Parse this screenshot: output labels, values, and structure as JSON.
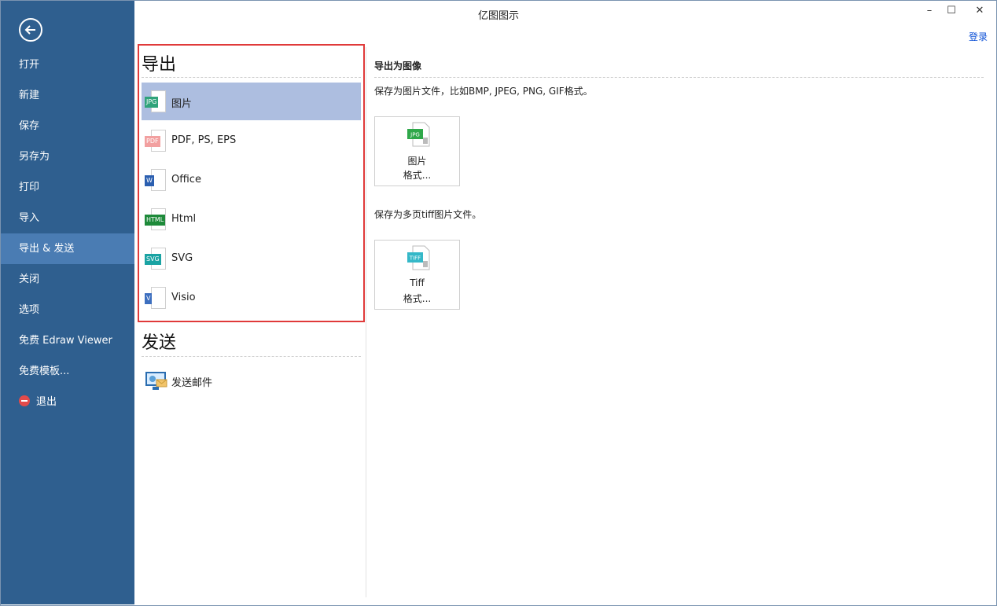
{
  "window": {
    "title": "亿图图示",
    "minimize": "–",
    "maximize": "☐",
    "close": "✕",
    "login": "登录"
  },
  "sidebar": {
    "items": [
      {
        "label": "打开",
        "active": false
      },
      {
        "label": "新建",
        "active": false
      },
      {
        "label": "保存",
        "active": false
      },
      {
        "label": "另存为",
        "active": false
      },
      {
        "label": "打印",
        "active": false
      },
      {
        "label": "导入",
        "active": false
      },
      {
        "label": "导出 & 发送",
        "active": true
      },
      {
        "label": "关闭",
        "active": false
      },
      {
        "label": "选项",
        "active": false
      },
      {
        "label": "免费 Edraw Viewer",
        "active": false
      },
      {
        "label": "免费模板...",
        "active": false
      },
      {
        "label": "退出",
        "active": false,
        "icon": "exit-icon"
      }
    ]
  },
  "export": {
    "title": "导出",
    "items": [
      {
        "label": "图片",
        "icon": "jpg-icon",
        "tag": "JPG",
        "color": "#2fa37a",
        "selected": true
      },
      {
        "label": "PDF, PS, EPS",
        "icon": "pdf-icon",
        "tag": "PDF",
        "color": "#f2a0a0",
        "selected": false
      },
      {
        "label": "Office",
        "icon": "word-icon",
        "tag": "W",
        "color": "#2b5fb0",
        "selected": false
      },
      {
        "label": "Html",
        "icon": "html-icon",
        "tag": "HTML",
        "color": "#1e8a3a",
        "selected": false
      },
      {
        "label": "SVG",
        "icon": "svg-icon",
        "tag": "SVG",
        "color": "#1aa3a3",
        "selected": false
      },
      {
        "label": "Visio",
        "icon": "visio-icon",
        "tag": "V",
        "color": "#3d6fbf",
        "selected": false
      }
    ]
  },
  "send": {
    "title": "发送",
    "items": [
      {
        "label": "发送邮件",
        "icon": "email-icon"
      }
    ]
  },
  "detail": {
    "title": "导出为图像",
    "desc1": "保存为图片文件，比如BMP, JPEG, PNG, GIF格式。",
    "btn1": {
      "line1": "图片",
      "line2": "格式...",
      "tag": "JPG",
      "color": "#2fa84a"
    },
    "desc2": "保存为多页tiff图片文件。",
    "btn2": {
      "line1": "Tiff",
      "line2": "格式...",
      "tag": "TIFF",
      "color": "#35b8c8"
    }
  }
}
